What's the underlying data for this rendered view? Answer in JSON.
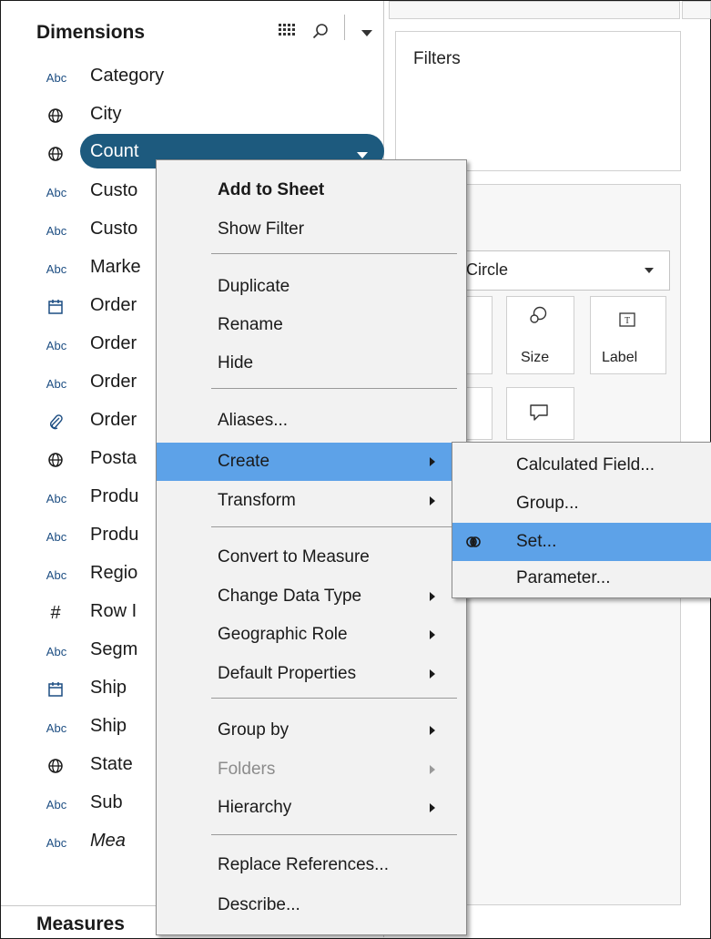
{
  "data_pane": {
    "dimensions_title": "Dimensions",
    "measures_title": "Measures",
    "fields": [
      {
        "icon": "abc",
        "icon_text": "Abc",
        "label": "Category"
      },
      {
        "icon": "globe",
        "icon_text": "",
        "label": "City"
      },
      {
        "icon": "globe",
        "icon_text": "",
        "label": "Count"
      },
      {
        "icon": "abc",
        "icon_text": "Abc",
        "label": "Custo"
      },
      {
        "icon": "abc",
        "icon_text": "Abc",
        "label": "Custo"
      },
      {
        "icon": "abc",
        "icon_text": "Abc",
        "label": "Marke"
      },
      {
        "icon": "calendar",
        "icon_text": "",
        "label": "Order"
      },
      {
        "icon": "abc",
        "icon_text": "Abc",
        "label": "Order"
      },
      {
        "icon": "abc",
        "icon_text": "Abc",
        "label": "Order"
      },
      {
        "icon": "paperclip",
        "icon_text": "",
        "label": "Order"
      },
      {
        "icon": "globe",
        "icon_text": "",
        "label": "Posta"
      },
      {
        "icon": "abc",
        "icon_text": "Abc",
        "label": "Produ"
      },
      {
        "icon": "abc",
        "icon_text": "Abc",
        "label": "Produ"
      },
      {
        "icon": "abc",
        "icon_text": "Abc",
        "label": "Regio"
      },
      {
        "icon": "hash",
        "icon_text": "#",
        "label": "Row I"
      },
      {
        "icon": "abc",
        "icon_text": "Abc",
        "label": "Segm"
      },
      {
        "icon": "calendar",
        "icon_text": "",
        "label": "Ship"
      },
      {
        "icon": "abc",
        "icon_text": "Abc",
        "label": "Ship"
      },
      {
        "icon": "globe",
        "icon_text": "",
        "label": "State"
      },
      {
        "icon": "abc",
        "icon_text": "Abc",
        "label": "Sub"
      },
      {
        "icon": "abc",
        "icon_text": "Abc",
        "label": "Mea"
      }
    ]
  },
  "right_panes": {
    "filters_label": "Filters",
    "mark_type": "Circle",
    "size_label": "Size",
    "label_label": "Label"
  },
  "context_menu": {
    "items": [
      {
        "label": "Add to Sheet",
        "bold": true
      },
      {
        "label": "Show Filter"
      },
      {
        "label": "Duplicate"
      },
      {
        "label": "Rename"
      },
      {
        "label": "Hide"
      },
      {
        "label": "Aliases..."
      },
      {
        "label": "Create",
        "submenu": true,
        "highlighted": true
      },
      {
        "label": "Transform",
        "submenu": true
      },
      {
        "label": "Convert to Measure"
      },
      {
        "label": "Change Data Type",
        "submenu": true
      },
      {
        "label": "Geographic Role",
        "submenu": true
      },
      {
        "label": "Default Properties",
        "submenu": true
      },
      {
        "label": "Group by",
        "submenu": true
      },
      {
        "label": "Folders",
        "submenu": true,
        "disabled": true
      },
      {
        "label": "Hierarchy",
        "submenu": true
      },
      {
        "label": "Replace References..."
      },
      {
        "label": "Describe..."
      }
    ]
  },
  "create_submenu": {
    "items": [
      {
        "label": "Calculated Field..."
      },
      {
        "label": "Group..."
      },
      {
        "label": "Set...",
        "highlighted": true,
        "icon": "set-icon"
      },
      {
        "label": "Parameter..."
      }
    ]
  },
  "colors": {
    "selected_pill": "#1d5a7e",
    "menu_highlight": "#5da2e8",
    "field_icon_blue": "#1c4d82"
  }
}
